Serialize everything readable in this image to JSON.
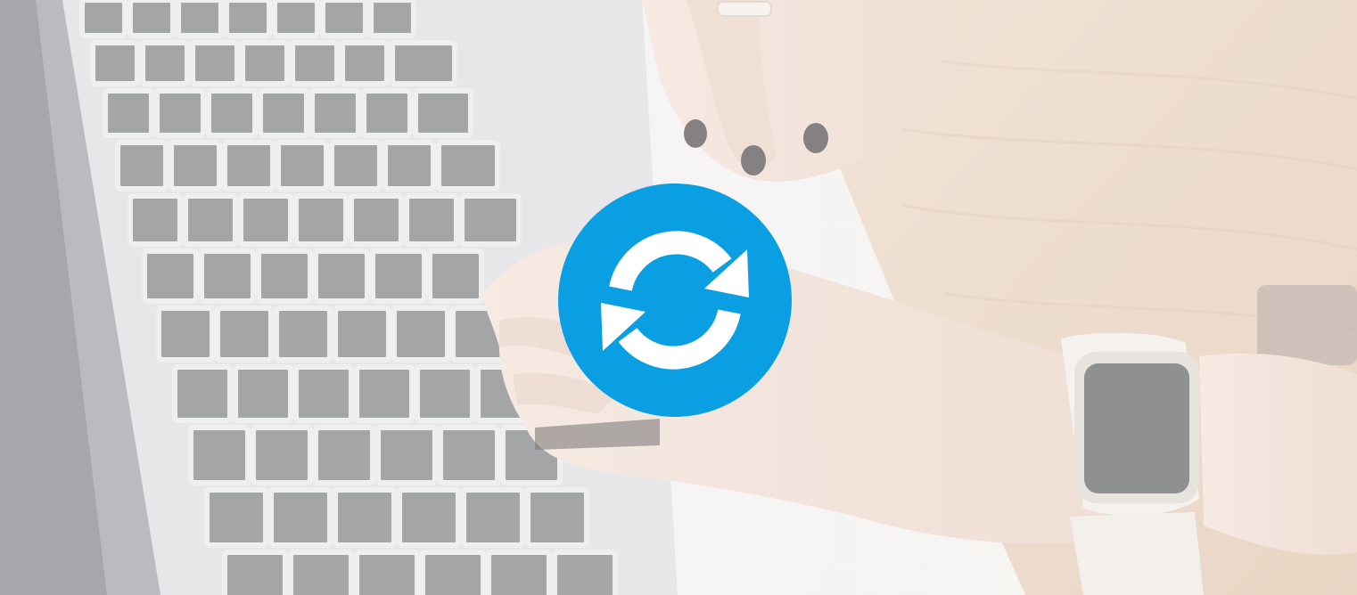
{
  "image": {
    "subject": "photo",
    "overlay_wash": "white",
    "colors": {
      "wash": "#ffffff",
      "laptop_body": "#d9d9db",
      "laptop_bezel": "#8f9296",
      "key": "#6c6e71",
      "key_border": "#e6e6e8",
      "desk": "#e2c6ad",
      "desk_grain": "#d8b89c",
      "skin": "#edd6c9",
      "skin_shadow": "#e0c2b2",
      "nail": "#3a3436",
      "watch_band": "#ede9e4",
      "watch_face": "#4a4c4f",
      "background_light": "#eeeff1"
    }
  },
  "sync_button": {
    "icon": "sync-icon",
    "fill_color": "#0a9fe3",
    "arrow_color": "#ffffff"
  }
}
